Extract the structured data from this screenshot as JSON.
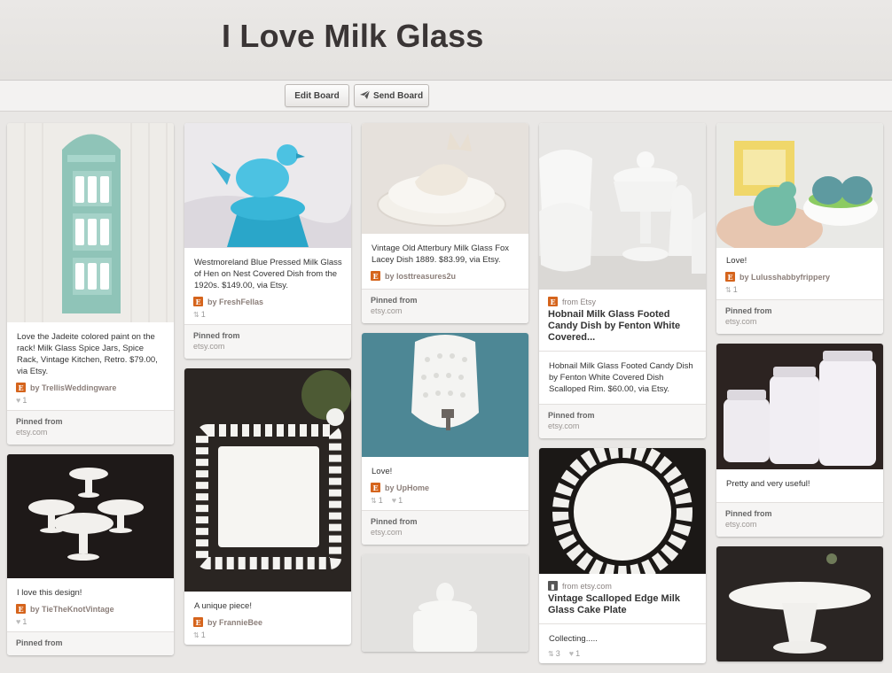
{
  "header": {
    "title": "I Love Milk Glass"
  },
  "toolbar": {
    "edit_label": "Edit Board",
    "send_label": "Send Board"
  },
  "columns": [
    [
      {
        "desc": "Love the Jadeite colored paint on the rack! Milk Glass Spice Jars, Spice Rack, Vintage Kitchen, Retro. $79.00, via Etsy.",
        "by": "by TrellisWeddingware",
        "likes": "1",
        "pinned_label": "Pinned from",
        "pinned_domain": "etsy.com"
      },
      {
        "desc": "I love this design!",
        "by": "by TieTheKnotVintage",
        "likes": "1",
        "pinned_label": "Pinned from",
        "pinned_domain": ""
      }
    ],
    [
      {
        "desc": "Westmoreland Blue Pressed Milk Glass of Hen on Nest Covered Dish from the 1920s. $149.00, via Etsy.",
        "by": "by FreshFellas",
        "repins": "1",
        "pinned_label": "Pinned from",
        "pinned_domain": "etsy.com"
      },
      {
        "desc": "A unique piece!",
        "by": "by FrannieBee",
        "repins": "1"
      }
    ],
    [
      {
        "desc": "Vintage Old Atterbury Milk Glass Fox Lacey Dish 1889. $83.99, via Etsy.",
        "by": "by losttreasures2u",
        "pinned_label": "Pinned from",
        "pinned_domain": "etsy.com"
      },
      {
        "desc": "Love!",
        "by": "by UpHome",
        "repins": "1",
        "likes": "1",
        "pinned_label": "Pinned from",
        "pinned_domain": "etsy.com"
      }
    ],
    [
      {
        "from": "from Etsy",
        "source_title": "Hobnail Milk Glass Footed Candy Dish by Fenton White Covered...",
        "desc": "Hobnail Milk Glass Footed Candy Dish by Fenton White Covered Dish Scalloped Rim. $60.00, via Etsy.",
        "pinned_label": "Pinned from",
        "pinned_domain": "etsy.com"
      },
      {
        "from": "from etsy.com",
        "source_title": "Vintage Scalloped Edge Milk Glass Cake Plate",
        "desc": "Collecting.....",
        "repins": "3",
        "likes": "1"
      }
    ],
    [
      {
        "desc": "Love!",
        "by": "by Lulusshabbyfrippery",
        "repins": "1",
        "pinned_label": "Pinned from",
        "pinned_domain": "etsy.com"
      },
      {
        "desc": "Pretty and very useful!",
        "pinned_label": "Pinned from",
        "pinned_domain": "etsy.com"
      }
    ]
  ],
  "colors": {
    "accent_etsy": "#d5641c",
    "background": "#e9e7e5",
    "card": "#ffffff"
  }
}
